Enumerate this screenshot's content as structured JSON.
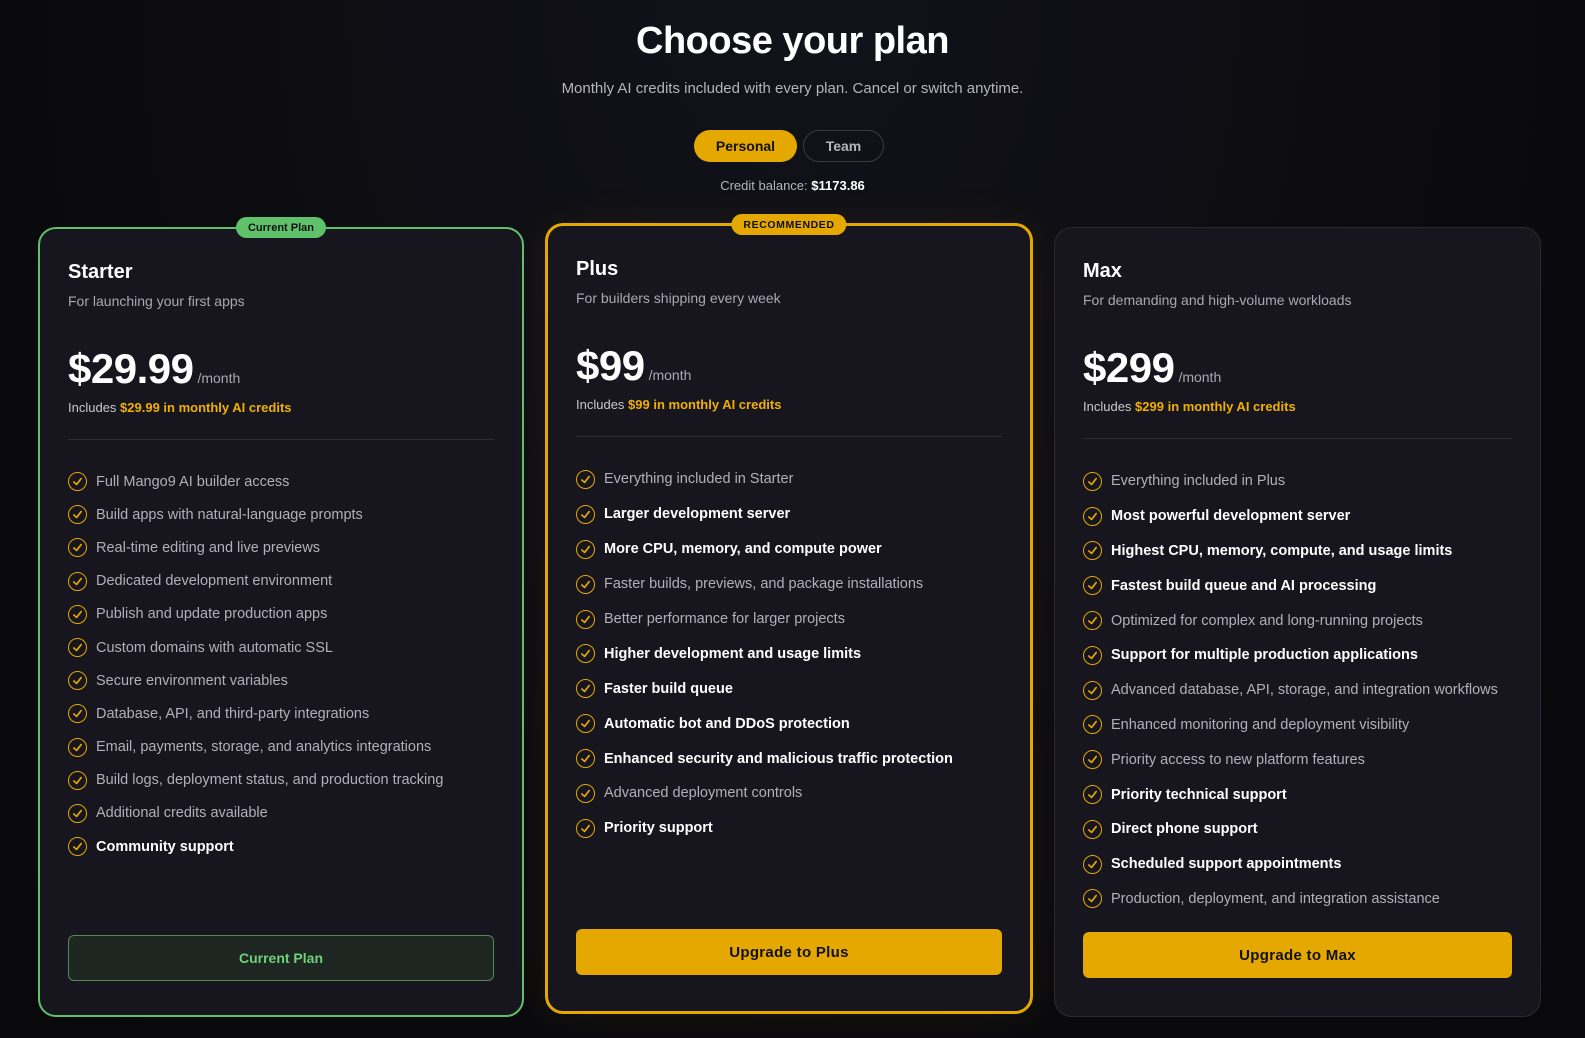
{
  "header": {
    "title": "Choose your plan",
    "subtitle": "Monthly AI credits included with every plan. Cancel or switch anytime."
  },
  "toggle": {
    "options": [
      "Personal",
      "Team"
    ],
    "selected": "Personal"
  },
  "balance": {
    "label": "Credit balance:",
    "value": "$1173.86"
  },
  "colors": {
    "accent": "#e4a800",
    "current_plan": "#5fc16a",
    "background": "#0c0c10",
    "card": "#17161e"
  },
  "plans": [
    {
      "badge": "Current Plan",
      "name": "Starter",
      "description": "For launching your first apps",
      "price": "$29.99",
      "period": "/month",
      "credits_prefix": "Includes",
      "credits_highlight": "$29.99 in monthly AI credits",
      "features": [
        {
          "text": "Full Mango9 AI builder access",
          "bold": false
        },
        {
          "text": "Build apps with natural-language prompts",
          "bold": false
        },
        {
          "text": "Real-time editing and live previews",
          "bold": false
        },
        {
          "text": "Dedicated development environment",
          "bold": false
        },
        {
          "text": "Publish and update production apps",
          "bold": false
        },
        {
          "text": "Custom domains with automatic SSL",
          "bold": false
        },
        {
          "text": "Secure environment variables",
          "bold": false
        },
        {
          "text": "Database, API, and third-party integrations",
          "bold": false
        },
        {
          "text": "Email, payments, storage, and analytics integrations",
          "bold": false
        },
        {
          "text": "Build logs, deployment status, and production tracking",
          "bold": false
        },
        {
          "text": "Additional credits available",
          "bold": false
        },
        {
          "text": "Community support",
          "bold": true
        }
      ],
      "cta": "Current Plan"
    },
    {
      "badge": "RECOMMENDED",
      "name": "Plus",
      "description": "For builders shipping every week",
      "price": "$99",
      "period": "/month",
      "credits_prefix": "Includes",
      "credits_highlight": "$99 in monthly AI credits",
      "features": [
        {
          "text": "Everything included in Starter",
          "bold": false
        },
        {
          "text": "Larger development server",
          "bold": true
        },
        {
          "text": "More CPU, memory, and compute power",
          "bold": true
        },
        {
          "text": "Faster builds, previews, and package installations",
          "bold": false
        },
        {
          "text": "Better performance for larger projects",
          "bold": false
        },
        {
          "text": "Higher development and usage limits",
          "bold": true
        },
        {
          "text": "Faster build queue",
          "bold": true
        },
        {
          "text": "Automatic bot and DDoS protection",
          "bold": true
        },
        {
          "text": "Enhanced security and malicious traffic protection",
          "bold": true
        },
        {
          "text": "Advanced deployment controls",
          "bold": false
        },
        {
          "text": "Priority support",
          "bold": true
        }
      ],
      "cta": "Upgrade to Plus"
    },
    {
      "badge": "",
      "name": "Max",
      "description": "For demanding and high-volume workloads",
      "price": "$299",
      "period": "/month",
      "credits_prefix": "Includes",
      "credits_highlight": "$299 in monthly AI credits",
      "features": [
        {
          "text": "Everything included in Plus",
          "bold": false
        },
        {
          "text": "Most powerful development server",
          "bold": true
        },
        {
          "text": "Highest CPU, memory, compute, and usage limits",
          "bold": true
        },
        {
          "text": "Fastest build queue and AI processing",
          "bold": true
        },
        {
          "text": "Optimized for complex and long-running projects",
          "bold": false
        },
        {
          "text": "Support for multiple production applications",
          "bold": true
        },
        {
          "text": "Advanced database, API, storage, and integration workflows",
          "bold": false
        },
        {
          "text": "Enhanced monitoring and deployment visibility",
          "bold": false
        },
        {
          "text": "Priority access to new platform features",
          "bold": false
        },
        {
          "text": "Priority technical support",
          "bold": true
        },
        {
          "text": "Direct phone support",
          "bold": true
        },
        {
          "text": "Scheduled support appointments",
          "bold": true
        },
        {
          "text": "Production, deployment, and integration assistance",
          "bold": false
        }
      ],
      "cta": "Upgrade to Max"
    }
  ]
}
